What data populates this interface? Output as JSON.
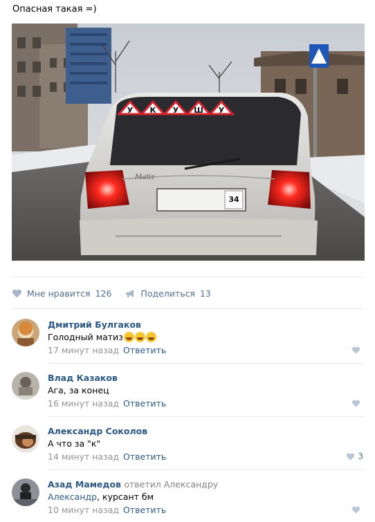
{
  "post": {
    "text": "Опасная такая =)",
    "photo": {
      "sign_letters": [
        "У",
        "К",
        "У",
        "Ш",
        "У"
      ],
      "car_badge": "Matiz",
      "plate_region": "34"
    }
  },
  "actions": {
    "like_label": "Мне нравится",
    "like_count": "126",
    "share_label": "Поделиться",
    "share_count": "13"
  },
  "comments": [
    {
      "author": "Дмитрий Булгаков",
      "text": "Голодный матиз",
      "emoji_count": 3,
      "time": "17 минут назад",
      "reply": "Ответить",
      "likes": ""
    },
    {
      "author": "Влад Казаков",
      "text": "Ага, за конец",
      "time": "16 минут назад",
      "reply": "Ответить",
      "likes": ""
    },
    {
      "author": "Александр Соколов",
      "text": "А что за \"к\"",
      "time": "14 минут назад",
      "reply": "Ответить",
      "likes": "3"
    },
    {
      "author": "Азад Мамедов",
      "reply_note": "ответил Александру",
      "mention": "Александр",
      "text": ", курсант бм",
      "time": "10 минут назад",
      "reply": "Ответить",
      "likes": ""
    }
  ],
  "colors": {
    "link": "#2a5885",
    "action": "#4f6f91",
    "meta": "#939393",
    "divider": "#e7e8ec"
  }
}
